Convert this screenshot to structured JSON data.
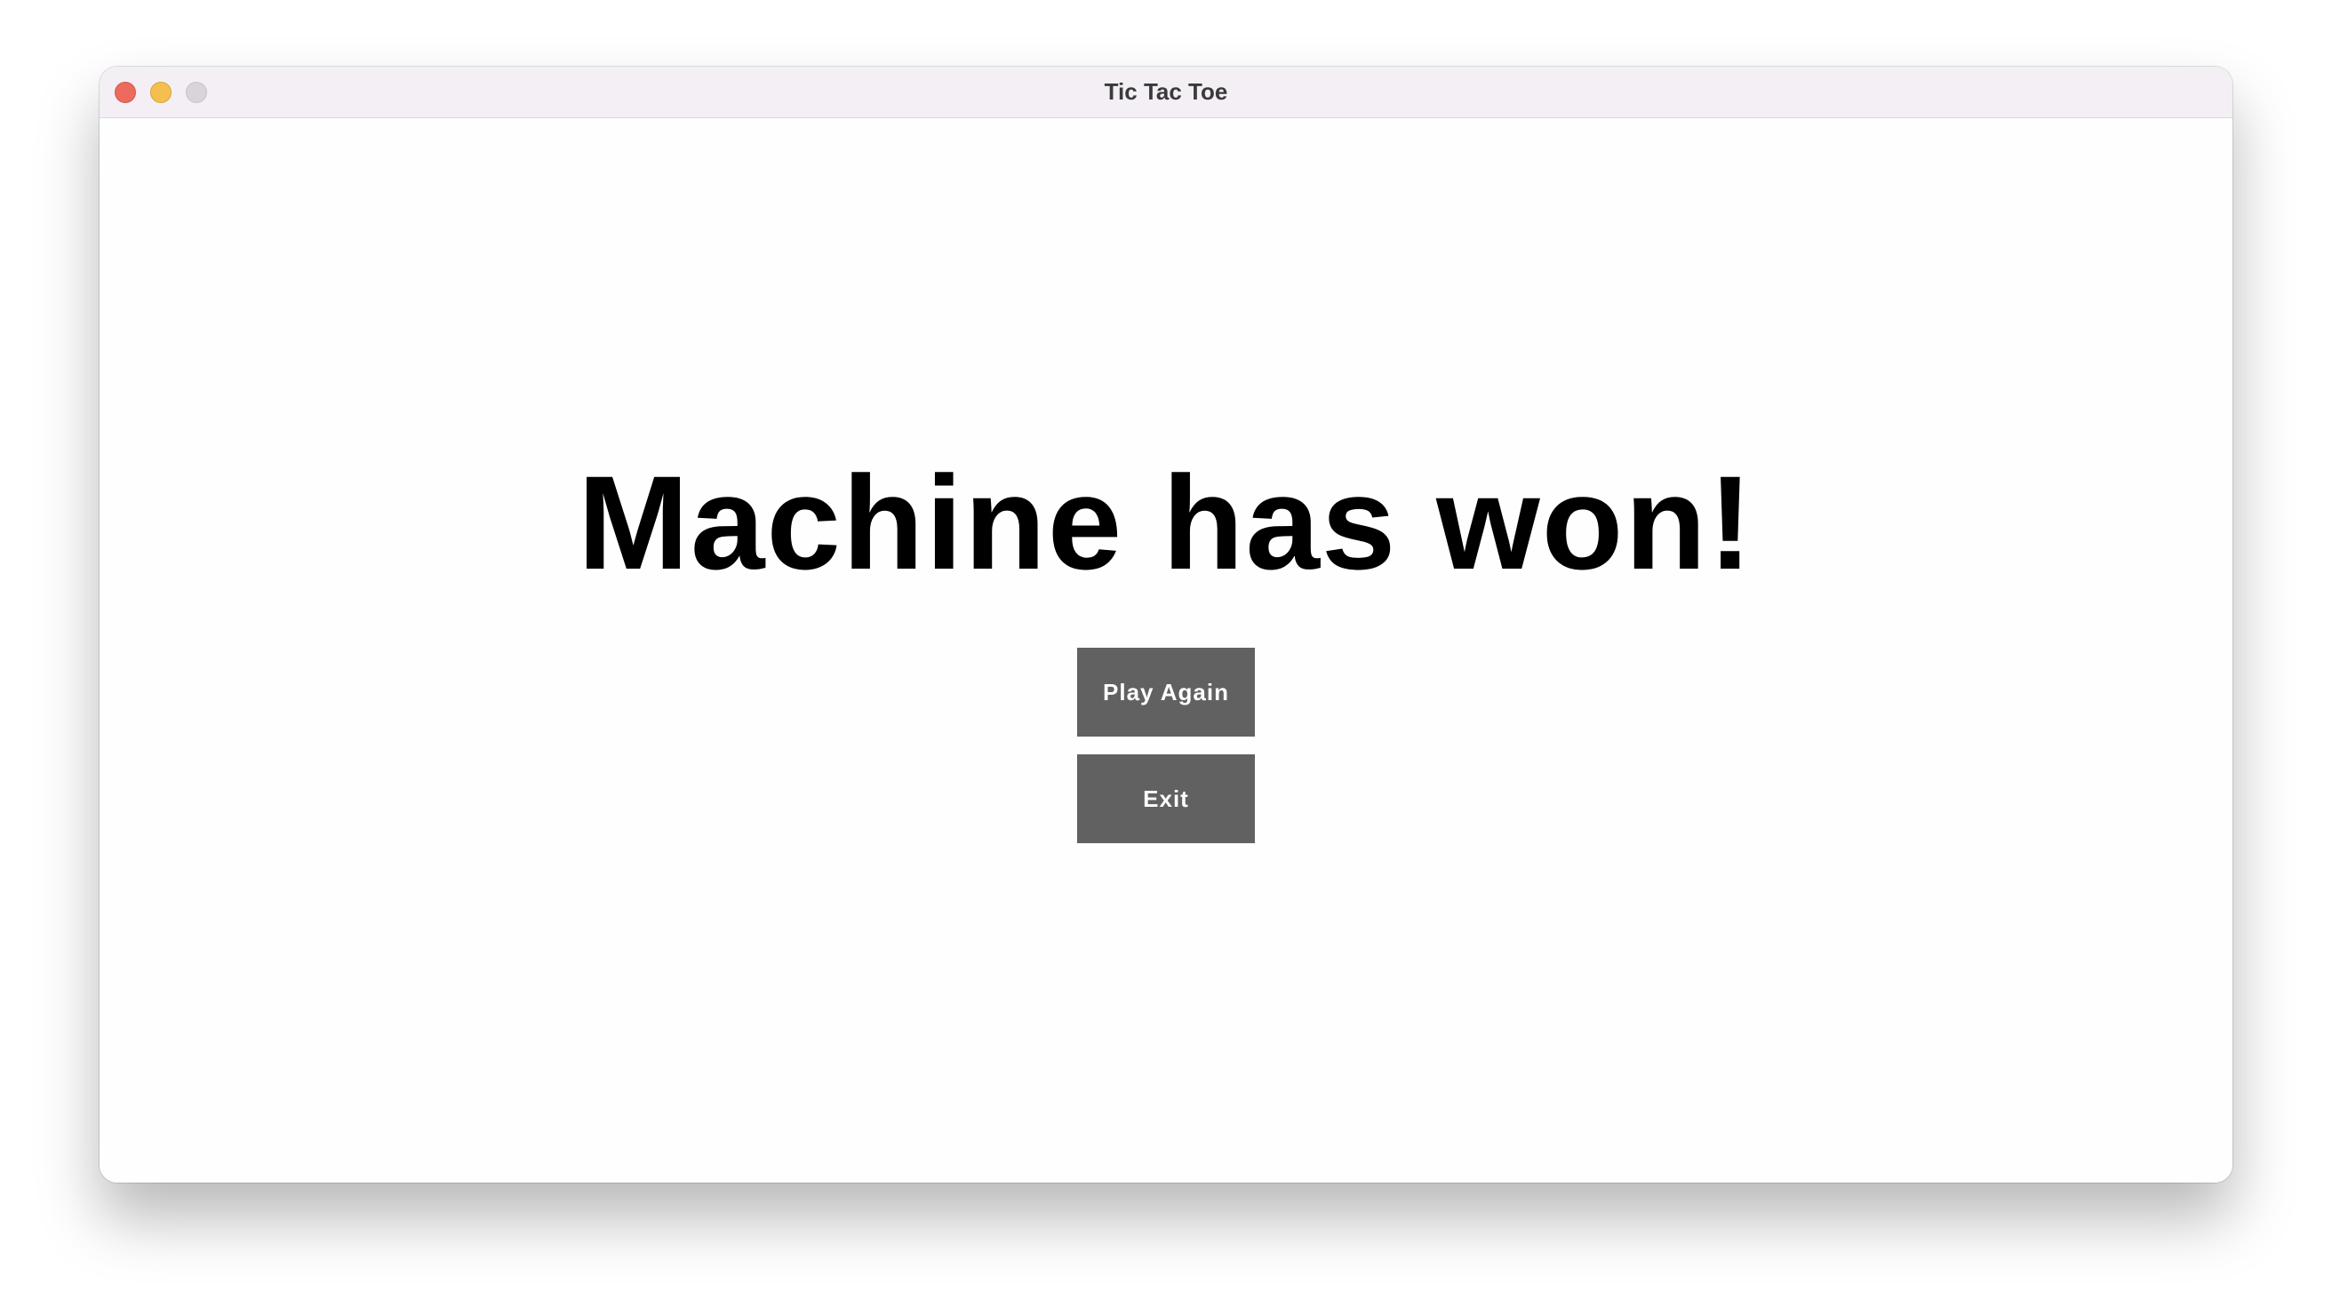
{
  "window": {
    "title": "Tic Tac Toe"
  },
  "game": {
    "result_message": "Machine has won!",
    "play_again_label": "Play Again",
    "exit_label": "Exit"
  },
  "colors": {
    "button_bg": "#616161",
    "button_text": "#ffffff",
    "traffic_close": "#ed6a5e",
    "traffic_minimize": "#f5bf4f",
    "traffic_zoom": "#d8d4da"
  }
}
